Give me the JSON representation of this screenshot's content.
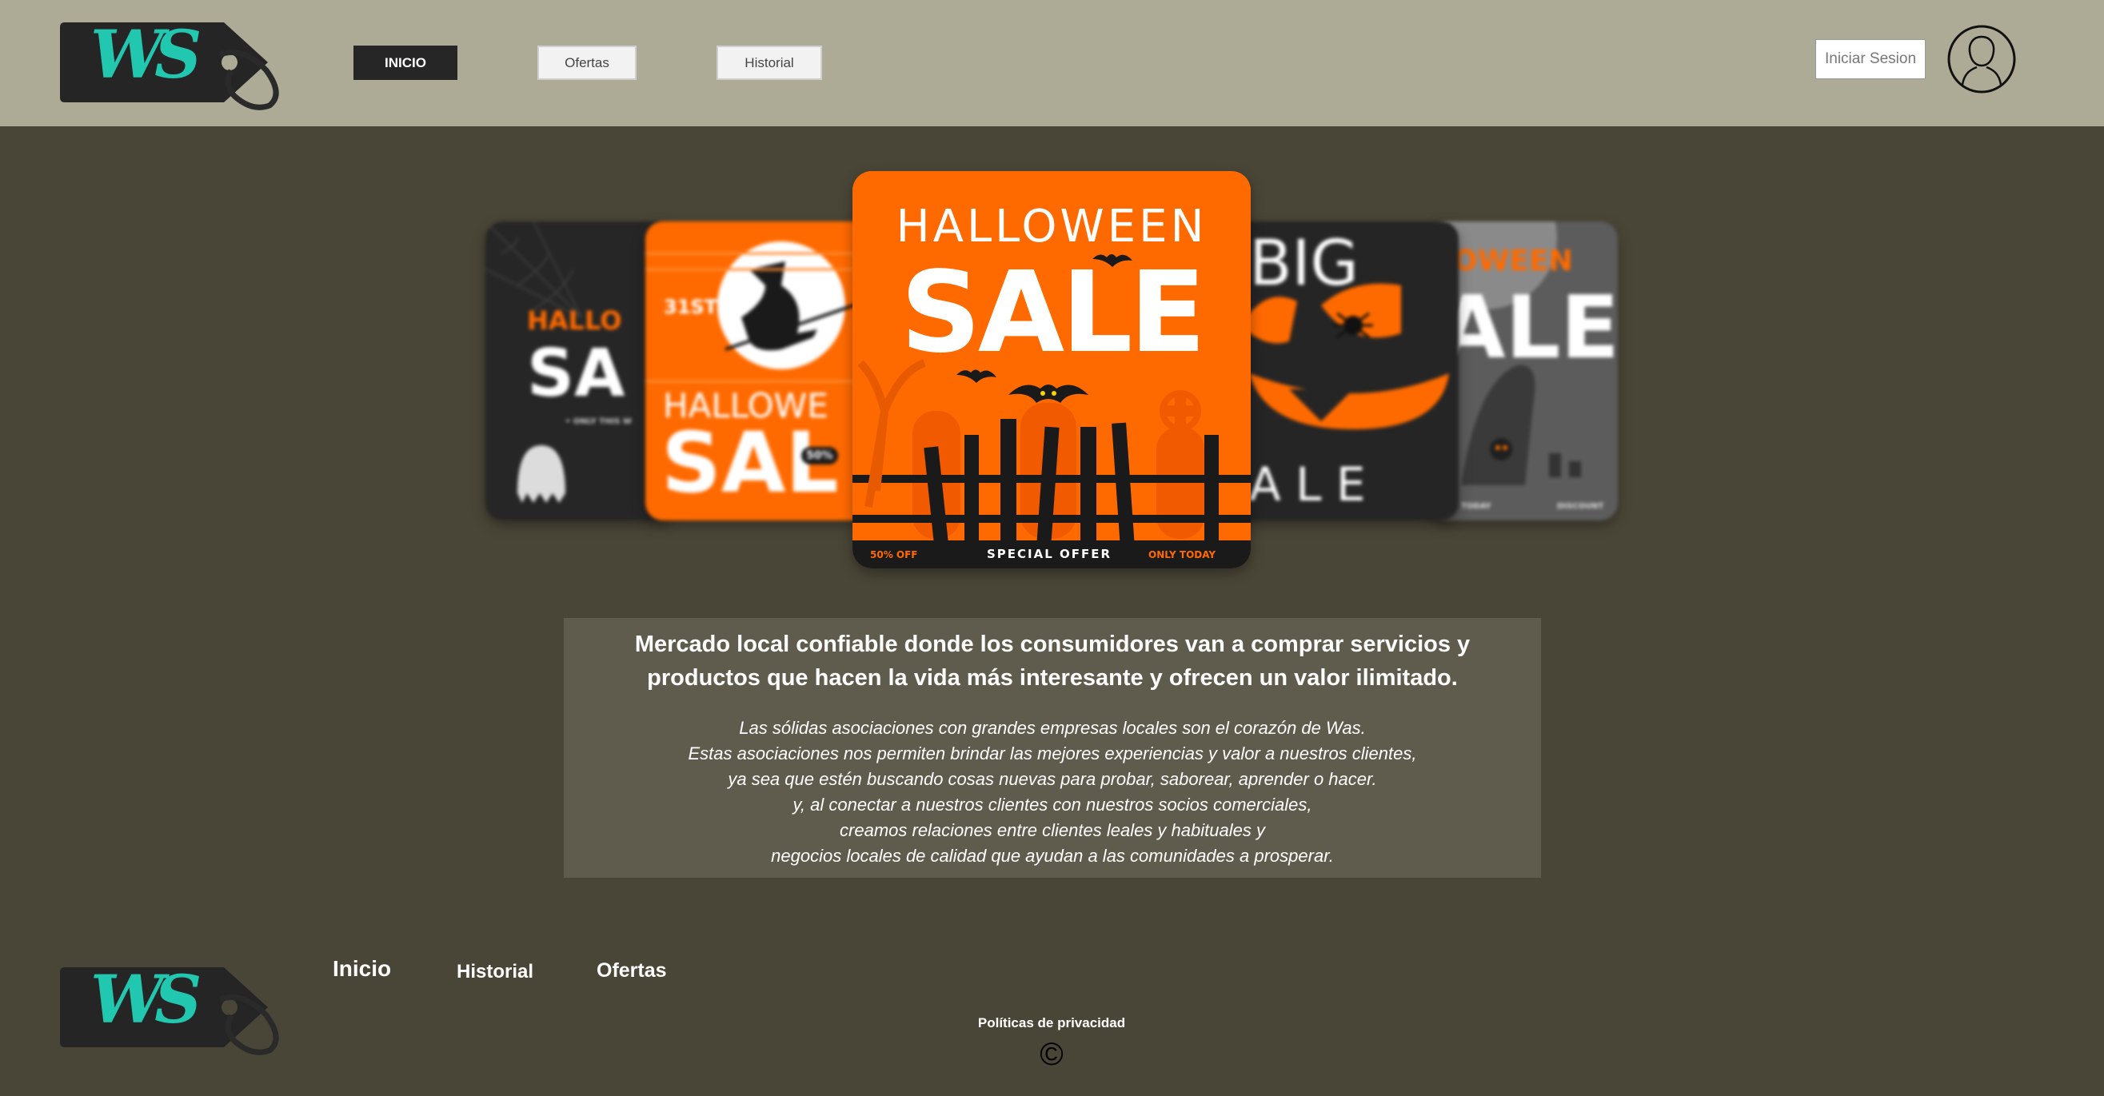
{
  "brand": {
    "logo_text": "WS"
  },
  "header": {
    "nav": {
      "inicio": "INICIO",
      "ofertas": "Ofertas",
      "historial": "Historial"
    },
    "login_label": "Iniciar Sesion"
  },
  "banners": {
    "card1": {
      "line1": "HALLO",
      "line2": "SA",
      "small": "• ONLY THIS W"
    },
    "card2": {
      "date": "31ST",
      "line1": "HALLOWE",
      "line2": "SAL",
      "badge": "50%"
    },
    "card3": {
      "line1": "HALLOWEEN",
      "line2": "SALE",
      "left": "50% OFF",
      "center": "SPECIAL OFFER",
      "right": "ONLY TODAY"
    },
    "card4": {
      "line1": "BIG",
      "line2": "A L E"
    },
    "card5": {
      "line1": "OWEEN",
      "line2": "ALE",
      "left": "TODAY",
      "right": "DISCOUNT"
    }
  },
  "mission": {
    "headline": "Mercado local confiable donde los consumidores van a comprar servicios y productos que hacen la vida más interesante y ofrecen un valor ilimitado.",
    "body": [
      "Las sólidas asociaciones con grandes empresas locales son el corazón de Was.",
      "Estas asociaciones nos permiten brindar las mejores experiencias y valor a nuestros clientes,",
      "ya sea que estén buscando cosas nuevas para probar, saborear, aprender o hacer.",
      "y, al conectar a nuestros clientes con nuestros socios comerciales,",
      "creamos relaciones entre clientes leales y habituales y",
      "negocios locales de calidad que ayudan a las comunidades a prosperar."
    ]
  },
  "footer": {
    "links": {
      "inicio": "Inicio",
      "historial": "Historial",
      "ofertas": "Ofertas"
    },
    "privacy": "Políticas de privacidad",
    "copyright": "©"
  },
  "colors": {
    "header_bg": "#adaa96",
    "page_bg": "#4a4637",
    "accent": "#22c7b0",
    "halloween_orange": "#ff6a00"
  }
}
